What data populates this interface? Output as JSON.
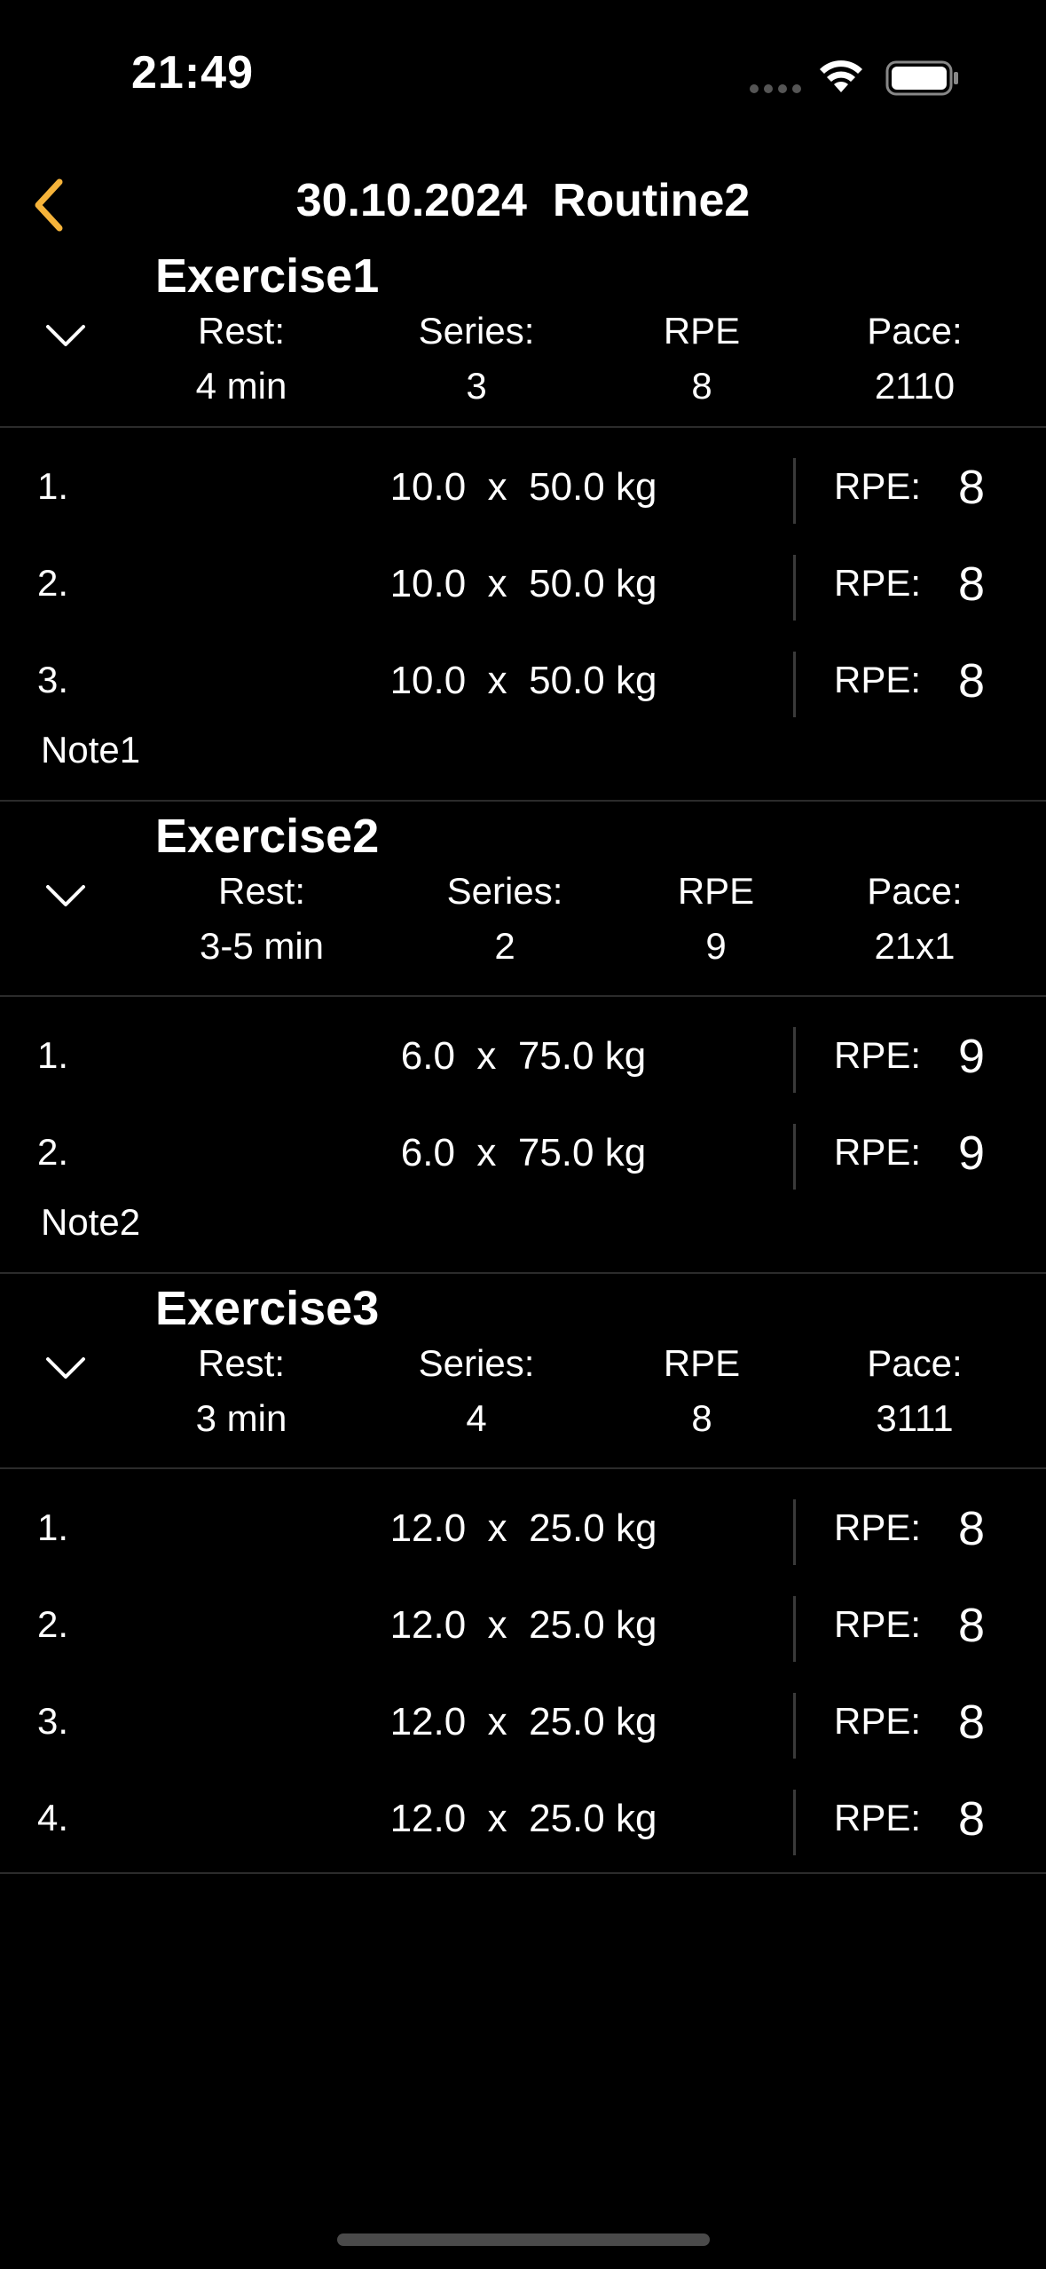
{
  "status_bar": {
    "time": "21:49",
    "icons": [
      "signal-dots-icon",
      "wifi-icon",
      "battery-icon"
    ]
  },
  "nav": {
    "title": "30.10.2024  Routine2",
    "back_icon": "chevron-left-icon",
    "accent_color": "#F5B33A"
  },
  "labels": {
    "rest": "Rest:",
    "series": "Series:",
    "rpe": "RPE",
    "pace": "Pace:",
    "set_rpe": "RPE:"
  },
  "exercises": [
    {
      "name": "Exercise1",
      "rest": "4 min",
      "series": "3",
      "rpe": "8",
      "pace": "2110",
      "sets": [
        {
          "num": "1.",
          "weight": "10.0  x  50.0 kg",
          "rpe": "8"
        },
        {
          "num": "2.",
          "weight": "10.0  x  50.0 kg",
          "rpe": "8"
        },
        {
          "num": "3.",
          "weight": "10.0  x  50.0 kg",
          "rpe": "8"
        }
      ],
      "note": "Note1"
    },
    {
      "name": "Exercise2",
      "rest": "3-5 min",
      "series": "2",
      "rpe": "9",
      "pace": "21x1",
      "sets": [
        {
          "num": "1.",
          "weight": "6.0  x  75.0 kg",
          "rpe": "9"
        },
        {
          "num": "2.",
          "weight": "6.0  x  75.0 kg",
          "rpe": "9"
        }
      ],
      "note": "Note2"
    },
    {
      "name": "Exercise3",
      "rest": "3 min",
      "series": "4",
      "rpe": "8",
      "pace": "3111",
      "sets": [
        {
          "num": "1.",
          "weight": "12.0  x  25.0 kg",
          "rpe": "8"
        },
        {
          "num": "2.",
          "weight": "12.0  x  25.0 kg",
          "rpe": "8"
        },
        {
          "num": "3.",
          "weight": "12.0  x  25.0 kg",
          "rpe": "8"
        },
        {
          "num": "4.",
          "weight": "12.0  x  25.0 kg",
          "rpe": "8"
        }
      ],
      "note": ""
    }
  ]
}
